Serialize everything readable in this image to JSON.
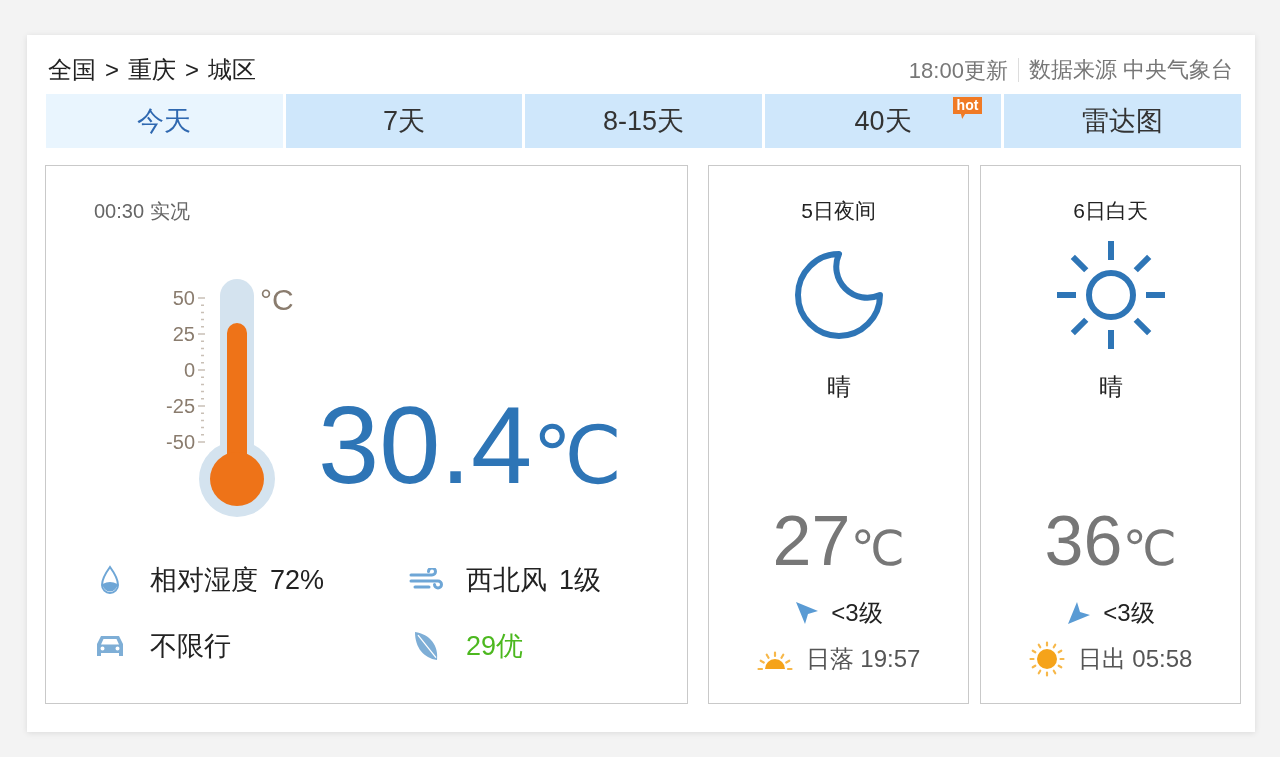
{
  "breadcrumb": [
    {
      "label": "全国",
      "separator": ">"
    },
    {
      "label": "重庆",
      "separator": ">"
    },
    {
      "label": "城区"
    }
  ],
  "header_info": {
    "updated": "18:00更新",
    "source": "数据来源 中央气象台"
  },
  "tabs": [
    {
      "label": "今天",
      "selected": true
    },
    {
      "label": "7天",
      "selected": false
    },
    {
      "label": "8-15天",
      "selected": false
    },
    {
      "label": "40天",
      "selected": false,
      "badge": "hot"
    },
    {
      "label": "雷达图",
      "selected": false
    }
  ],
  "current": {
    "time": "00:30 实况",
    "thermometer": {
      "scale": [
        "50",
        "25",
        "0",
        "-25",
        "-50"
      ],
      "unit": "°C",
      "level": 0.73
    },
    "temperature": "30.4",
    "unit": "℃",
    "details": [
      {
        "kind": "humidity",
        "label": "相对湿度",
        "value": "72%",
        "color": "#222222"
      },
      {
        "kind": "wind",
        "label": "西北风",
        "value": "1级",
        "color": "#222222"
      },
      {
        "kind": "traffic",
        "label": "不限行",
        "color": "#222222"
      },
      {
        "kind": "air_quality",
        "label": "29优",
        "color": "#4cb81f"
      }
    ]
  },
  "forecast": [
    {
      "kind": "night",
      "period": "5日夜间",
      "weather": "晴",
      "temperature": "27",
      "unit": "℃",
      "wind": {
        "kind": "up-left",
        "text": "<3级"
      },
      "sun_event": {
        "kind": "sunset",
        "text": "日落 19:57"
      }
    },
    {
      "kind": "day",
      "period": "6日白天",
      "weather": "晴",
      "temperature": "36",
      "unit": "℃",
      "wind": {
        "kind": "down-left",
        "text": "<3级"
      },
      "sun_event": {
        "kind": "sunrise",
        "text": "日出 05:58"
      }
    }
  ]
}
